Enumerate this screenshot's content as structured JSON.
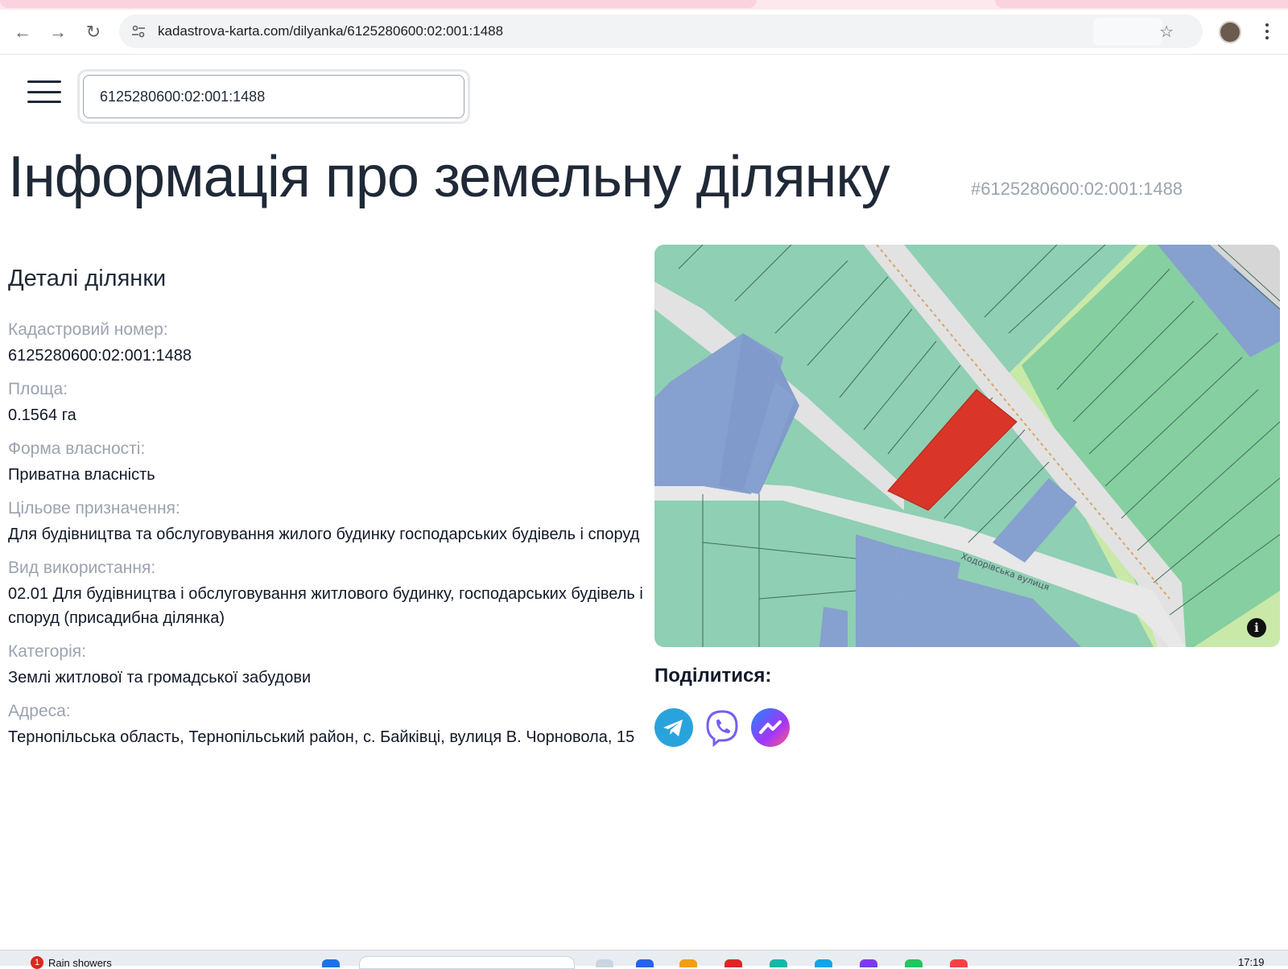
{
  "browser": {
    "url": "kadastrova-karta.com/dilyanka/6125280600:02:001:1488"
  },
  "search": {
    "value": "6125280600:02:001:1488"
  },
  "header": {
    "title": "Інформація про земельну ділянку",
    "subtitle": "#6125280600:02:001:1488"
  },
  "details": {
    "heading": "Деталі ділянки",
    "fields": [
      {
        "label": "Кадастровий номер:",
        "value": "6125280600:02:001:1488"
      },
      {
        "label": "Площа:",
        "value": "0.1564 га"
      },
      {
        "label": "Форма власності:",
        "value": "Приватна власність"
      },
      {
        "label": "Цільове призначення:",
        "value": "Для будівництва та обслуговування жилого будинку господарських будівель і споруд"
      },
      {
        "label": "Вид використання:",
        "value": "02.01 Для будівництва і обслуговування житлового будинку, господарських будівель і споруд (присадибна ділянка)"
      },
      {
        "label": "Категорія:",
        "value": "Землі житлової та громадської забудови"
      },
      {
        "label": "Адреса:",
        "value": "Тернопільська область, Тернопільський район, с. Байківці, вулиця В. Чорновола, 15"
      }
    ]
  },
  "map": {
    "street_label": "Ходорівська вулиця",
    "colors": {
      "parcel_green": "#8fcfb3",
      "parcel_blue": "#86a0cf",
      "parcel_lightgreen": "#c9e9a8",
      "highlight": "#d93528",
      "road": "#e2e2e2"
    }
  },
  "share": {
    "title": "Поділитися:",
    "buttons": [
      "telegram-icon",
      "viber-icon",
      "messenger-icon"
    ]
  },
  "taskbar": {
    "weather_badge": "1",
    "weather_text": "Rain showers",
    "clock": "17:19"
  }
}
